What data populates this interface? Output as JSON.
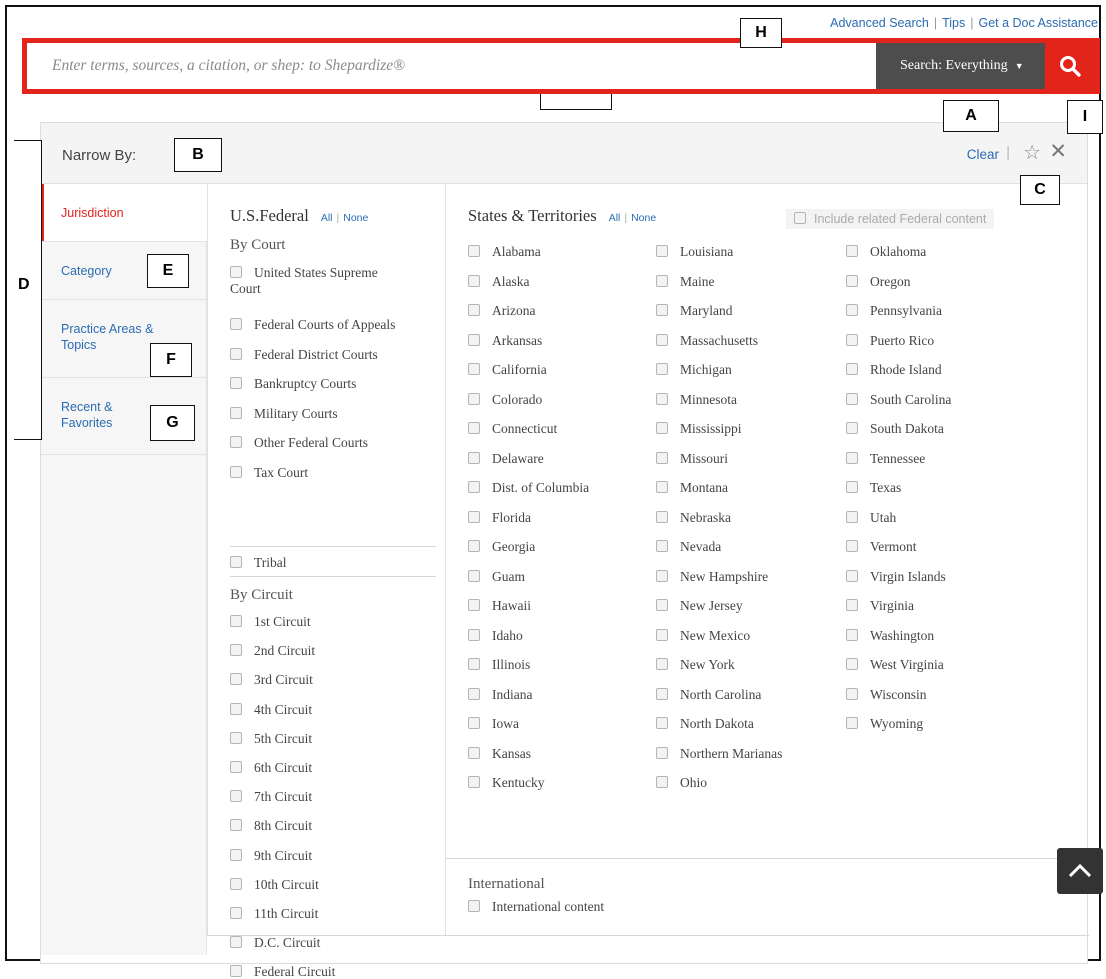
{
  "top_links": [
    "Advanced Search",
    "Tips",
    "Get a Doc Assistance"
  ],
  "search": {
    "placeholder": "Enter terms, sources, a citation, or shep: to Shepardize®",
    "scope_label": "Search: Everything"
  },
  "callouts": [
    "H",
    "A",
    "I",
    "B",
    "C",
    "D",
    "E",
    "F",
    "G"
  ],
  "panel": {
    "title": "Narrow By:",
    "clear_label": "Clear"
  },
  "nav": [
    {
      "label": "Jurisdiction",
      "active": true
    },
    {
      "label": "Category",
      "active": false
    },
    {
      "label": "Practice Areas & Topics",
      "active": false
    },
    {
      "label": "Recent & Favorites",
      "active": false
    }
  ],
  "federal": {
    "title": "U.S.Federal",
    "all": "All",
    "none": "None",
    "by_court_label": "By Court",
    "courts": [
      "United States Supreme Court",
      "Federal Courts of Appeals",
      "Federal District Courts",
      "Bankruptcy Courts",
      "Military Courts",
      "Other Federal Courts",
      "Tax Court"
    ],
    "tribal": "Tribal",
    "by_circuit_label": "By Circuit",
    "circuits": [
      "1st Circuit",
      "2nd Circuit",
      "3rd Circuit",
      "4th Circuit",
      "5th Circuit",
      "6th Circuit",
      "7th Circuit",
      "8th Circuit",
      "9th Circuit",
      "10th Circuit",
      "11th Circuit",
      "D.C. Circuit",
      "Federal Circuit"
    ]
  },
  "states": {
    "title": "States & Territories",
    "all": "All",
    "none": "None",
    "include_federal": "Include related Federal content",
    "col1": [
      "Alabama",
      "Alaska",
      "Arizona",
      "Arkansas",
      "California",
      "Colorado",
      "Connecticut",
      "Delaware",
      "Dist. of Columbia",
      "Florida",
      "Georgia",
      "Guam",
      "Hawaii",
      "Idaho",
      "Illinois",
      "Indiana",
      "Iowa",
      "Kansas",
      "Kentucky"
    ],
    "col2": [
      "Louisiana",
      "Maine",
      "Maryland",
      "Massachusetts",
      "Michigan",
      "Minnesota",
      "Mississippi",
      "Missouri",
      "Montana",
      "Nebraska",
      "Nevada",
      "New Hampshire",
      "New Jersey",
      "New Mexico",
      "New York",
      "North Carolina",
      "North Dakota",
      "Northern Marianas",
      "Ohio"
    ],
    "col3": [
      "Oklahoma",
      "Oregon",
      "Pennsylvania",
      "Puerto Rico",
      "Rhode Island",
      "South Carolina",
      "South Dakota",
      "Tennessee",
      "Texas",
      "Utah",
      "Vermont",
      "Virgin Islands",
      "Virginia",
      "Washington",
      "West Virginia",
      "Wisconsin",
      "Wyoming"
    ]
  },
  "international": {
    "title": "International",
    "item": "International content"
  },
  "colors": {
    "accent_red": "#e3241b",
    "link_blue": "#2b6cb0",
    "scope_bg": "#4d4d4d"
  }
}
